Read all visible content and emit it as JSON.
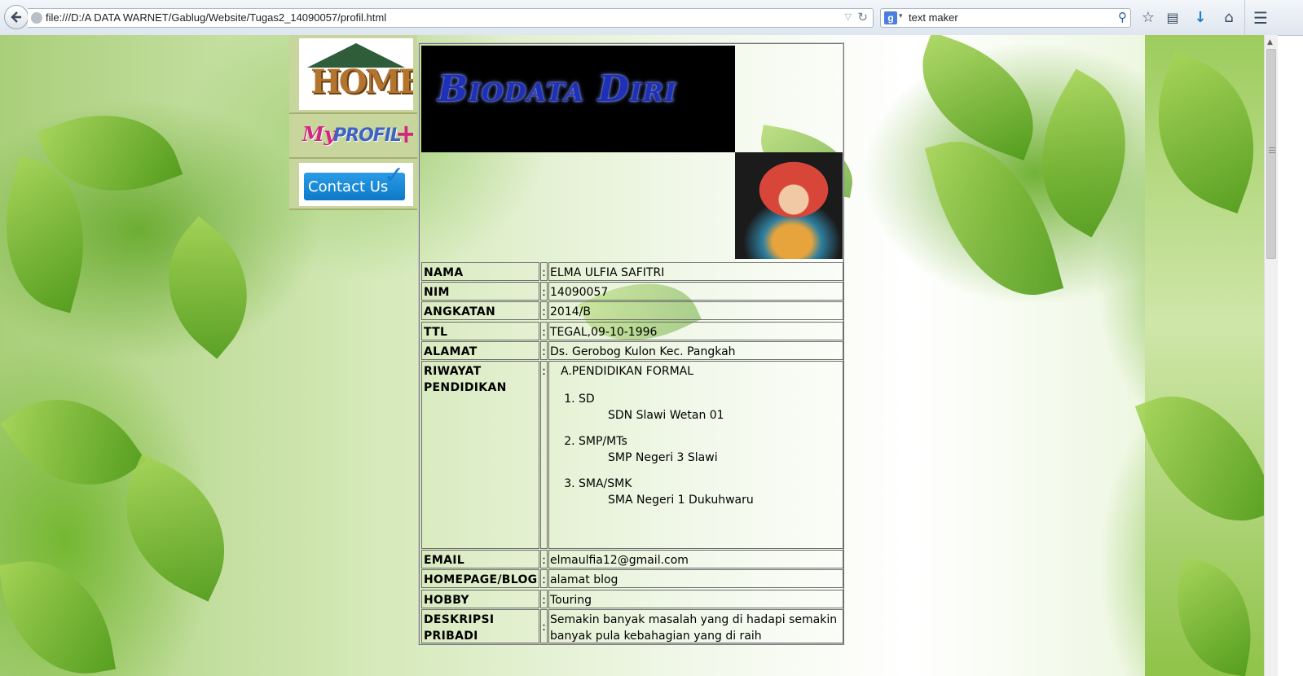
{
  "browser": {
    "url": "file:///D:/A DATA WARNET/Gablug/Website/Tugas2_14090057/profil.html",
    "search_text": "text maker",
    "search_engine_icon": "google-icon",
    "toolbar_icons": [
      "bookmark-star-icon",
      "reading-list-icon",
      "download-icon",
      "home-icon",
      "menu-icon"
    ]
  },
  "nav": {
    "home_label": "HOME",
    "profil_label_my": "My",
    "profil_label_word": "PROFIL",
    "contact_label": "Contact Us"
  },
  "banner": {
    "title": "Biodata Diri"
  },
  "biodata": {
    "separator": ":",
    "nama": {
      "label": "NAMA",
      "value": "ELMA ULFIA SAFITRI"
    },
    "nim": {
      "label": "NIM",
      "value": "14090057"
    },
    "angkatan": {
      "label": "ANGKATAN",
      "value": "2014/B"
    },
    "ttl": {
      "label": "TTL",
      "value": "TEGAL,09-10-1996"
    },
    "alamat": {
      "label": "ALAMAT",
      "value": "Ds. Gerobog Kulon Kec. Pangkah"
    },
    "riwayat": {
      "label_1": "RIWAYAT",
      "label_2": "PENDIDIKAN",
      "heading": "A.PENDIDIKAN FORMAL",
      "items": [
        {
          "level": "SD",
          "school": "SDN Slawi Wetan 01"
        },
        {
          "level": "SMP/MTs",
          "school": "SMP Negeri 3 Slawi"
        },
        {
          "level": "SMA/SMK",
          "school": "SMA Negeri 1 Dukuhwaru"
        }
      ]
    },
    "email": {
      "label": "EMAIL",
      "value": "elmaulfia12@gmail.com"
    },
    "homepage": {
      "label": "HOMEPAGE/BLOG",
      "value": "alamat blog"
    },
    "hobby": {
      "label": "HOBBY",
      "value": "Touring"
    },
    "deskripsi": {
      "label_1": "DESKRIPSI",
      "label_2": "PRIBADI",
      "value": "Semakin banyak masalah yang di hadapi semakin banyak pula kebahagian yang di raih"
    }
  }
}
